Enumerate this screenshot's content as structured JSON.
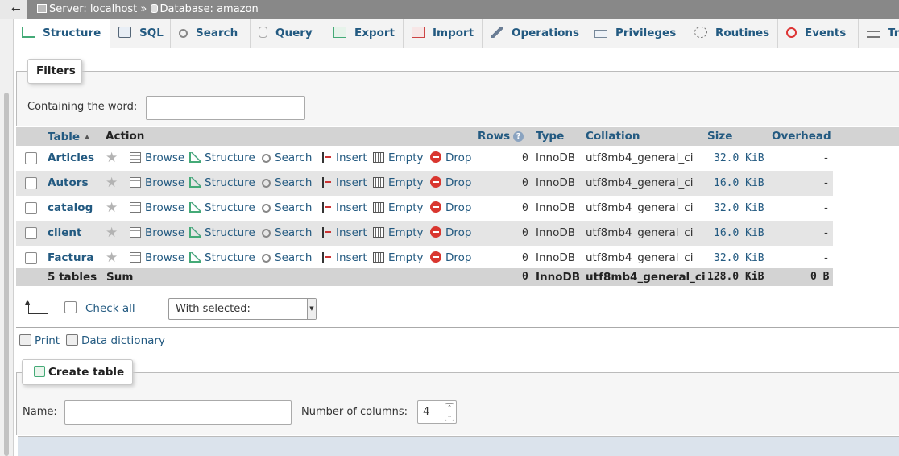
{
  "breadcrumb": {
    "back_label": "←",
    "server": "Server: localhost",
    "separator": "»",
    "database": "Database: amazon"
  },
  "tabs": [
    {
      "label": "Structure",
      "icon": "structure-icon"
    },
    {
      "label": "SQL",
      "icon": "sql-icon"
    },
    {
      "label": "Search",
      "icon": "search-icon"
    },
    {
      "label": "Query",
      "icon": "query-icon"
    },
    {
      "label": "Export",
      "icon": "export-icon"
    },
    {
      "label": "Import",
      "icon": "import-icon"
    },
    {
      "label": "Operations",
      "icon": "wrench-icon"
    },
    {
      "label": "Privileges",
      "icon": "privileges-icon"
    },
    {
      "label": "Routines",
      "icon": "routines-icon"
    },
    {
      "label": "Events",
      "icon": "clock-icon"
    },
    {
      "label": "Tr",
      "icon": "triggers-icon"
    }
  ],
  "filters": {
    "legend": "Filters",
    "label": "Containing the word:",
    "value": ""
  },
  "table": {
    "headers": {
      "table": "Table",
      "action": "Action",
      "rows": "Rows",
      "help": "?",
      "type": "Type",
      "collation": "Collation",
      "size": "Size",
      "overhead": "Overhead"
    },
    "actions": {
      "browse": "Browse",
      "structure": "Structure",
      "search": "Search",
      "insert": "Insert",
      "empty": "Empty",
      "drop": "Drop"
    },
    "rows": [
      {
        "name": "Articles",
        "rows": "0",
        "type": "InnoDB",
        "collation": "utf8mb4_general_ci",
        "size": "32.0 KiB",
        "overhead": "-"
      },
      {
        "name": "Autors",
        "rows": "0",
        "type": "InnoDB",
        "collation": "utf8mb4_general_ci",
        "size": "16.0 KiB",
        "overhead": "-"
      },
      {
        "name": "catalog",
        "rows": "0",
        "type": "InnoDB",
        "collation": "utf8mb4_general_ci",
        "size": "32.0 KiB",
        "overhead": "-"
      },
      {
        "name": "client",
        "rows": "0",
        "type": "InnoDB",
        "collation": "utf8mb4_general_ci",
        "size": "16.0 KiB",
        "overhead": "-"
      },
      {
        "name": "Factura",
        "rows": "0",
        "type": "InnoDB",
        "collation": "utf8mb4_general_ci",
        "size": "32.0 KiB",
        "overhead": "-"
      }
    ],
    "summary": {
      "count": "5 tables",
      "label": "Sum",
      "rows": "0",
      "type": "InnoDB",
      "collation": "utf8mb4_general_ci",
      "size": "128.0 KiB",
      "overhead": "0 B"
    }
  },
  "bulk": {
    "check_all": "Check all",
    "with_selected": "With selected:"
  },
  "links": {
    "print": "Print",
    "data_dictionary": "Data dictionary"
  },
  "create_table": {
    "legend": "Create table",
    "name_label": "Name:",
    "name_value": "",
    "columns_label": "Number of columns:",
    "columns_value": "4"
  }
}
